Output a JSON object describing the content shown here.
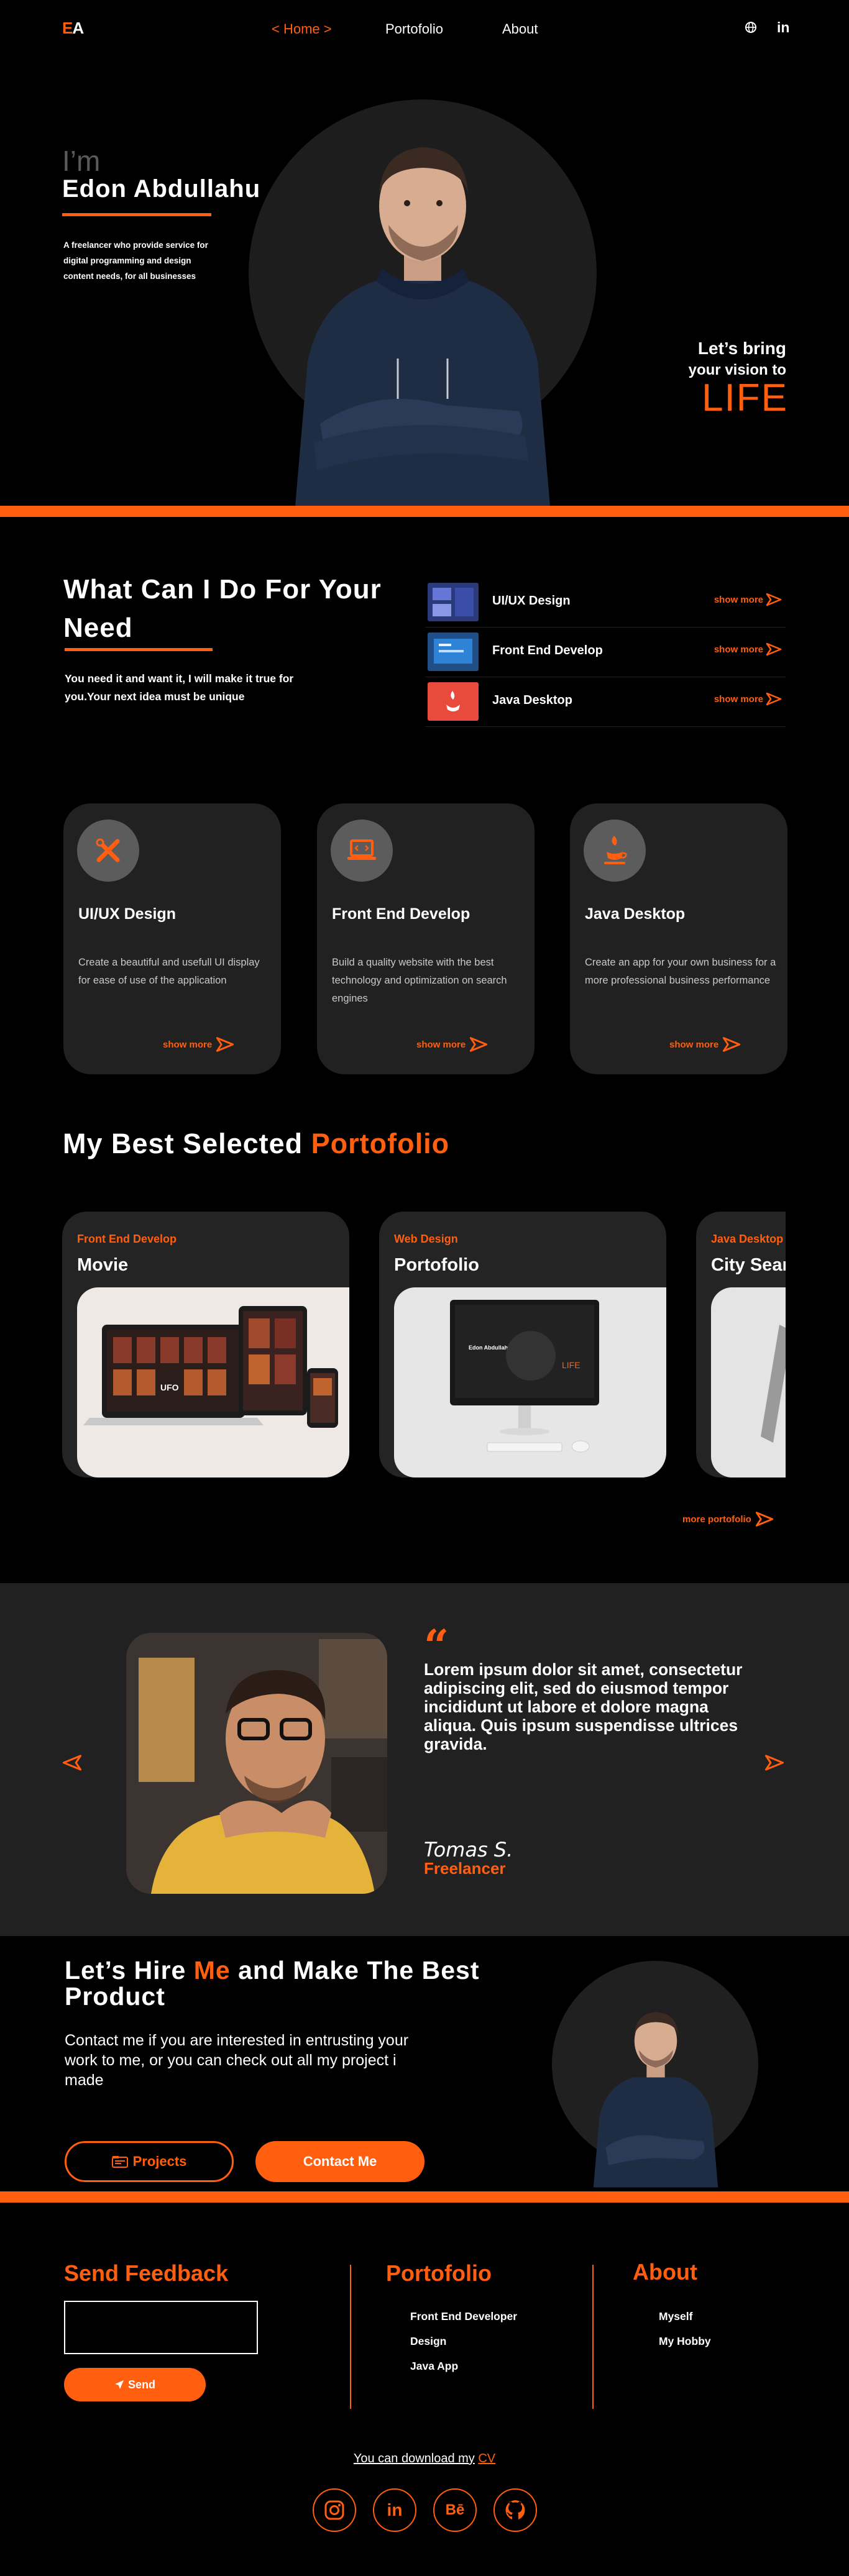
{
  "nav": {
    "logo_e": "E",
    "logo_a": "A",
    "home": "< Home >",
    "portfolio": "Portofolio",
    "about": "About",
    "globe_icon": "globe-icon",
    "linkedin_label": "in"
  },
  "hero": {
    "intro": "I’m",
    "name": "Edon Abdullahu",
    "description": "A freelancer who provide service for digital programming and design content needs, for all businesses",
    "vision_line1": "Let’s bring",
    "vision_line2": "your vision to",
    "vision_word": "LIFE"
  },
  "services": {
    "title": "What Can I Do For Your Need",
    "description": "You need it and want it, I will make it true for you.Your next idea must be unique",
    "list": [
      {
        "name": "UI/UX Design",
        "more": "show more"
      },
      {
        "name": "Front End Develop",
        "more": "show more"
      },
      {
        "name": "Java Desktop",
        "more": "show more"
      }
    ],
    "cards": [
      {
        "title": "UI/UX Design",
        "description": "Create a beautiful and usefull UI display for  ease of use of the application",
        "more": "show more",
        "icon": "design-tools-icon"
      },
      {
        "title": "Front End Develop",
        "description": "Build a quality website with the best technology and optimization on search engines",
        "more": "show more",
        "icon": "code-laptop-icon"
      },
      {
        "title": "Java Desktop",
        "description": "Create an app for your own business for a more professional business performance",
        "more": "show more",
        "icon": "java-cup-icon"
      }
    ]
  },
  "portfolio": {
    "title_white": "My Best Selected",
    "title_orange": "Portofolio",
    "items": [
      {
        "category": "Front End Develop",
        "name": "Movie"
      },
      {
        "category": "Web Design",
        "name": "Portofolio"
      },
      {
        "category": "Java Desktop",
        "name": "City Search"
      }
    ],
    "more": "more portofolio",
    "mockup_ufo": "UFO",
    "mockup_name": "Edon Abdullahu",
    "mockup_life": "LIFE"
  },
  "testimonial": {
    "quote_mark": "“",
    "text": "Lorem ipsum dolor sit amet, consectetur adipiscing elit, sed do eiusmod tempor incididunt ut labore et dolore magna aliqua. Quis ipsum suspendisse ultrices gravida.",
    "name": "Tomas S.",
    "role": "Freelancer"
  },
  "hire": {
    "title_a": "Let’s Hire",
    "title_me": "Me",
    "title_b": "and Make The Best Product",
    "description": "Contact me if you are interested in entrusting your work to me, or you can check out all my project i made",
    "projects_btn": "Projects",
    "contact_btn": "Contact Me"
  },
  "footer": {
    "feedback_title": "Send Feedback",
    "send_btn": "Send",
    "portfolio_title": "Portofolio",
    "portfolio_links": [
      "Front End Developer",
      "Design",
      "Java App"
    ],
    "about_title": "About",
    "about_links": [
      "Myself",
      "My Hobby"
    ],
    "cv_text": "You can download my",
    "cv_link": "CV",
    "social": [
      "instagram-icon",
      "linkedin-icon",
      "behance-icon",
      "github-icon"
    ],
    "linkedin_label": "in",
    "behance_label": "Bē"
  },
  "colors": {
    "accent": "#ff5f0f",
    "background": "#000000",
    "card": "#212121"
  }
}
